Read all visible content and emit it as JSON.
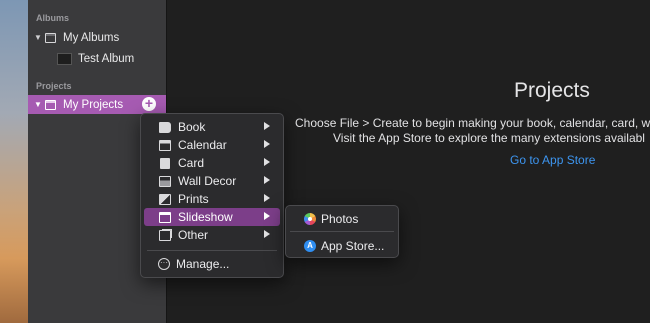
{
  "sidebar": {
    "albums_header": "Albums",
    "my_albums_label": "My Albums",
    "test_album_label": "Test Album",
    "projects_header": "Projects",
    "my_projects_label": "My Projects",
    "add_symbol": "+",
    "disclosure_symbol": "▼"
  },
  "main": {
    "title": "Projects",
    "line1": "Choose File > Create to begin making your book, calendar, card, w",
    "line2": "Visit the App Store to explore the many extensions availabl",
    "store_link": "Go to App Store"
  },
  "context_menu": {
    "items": [
      {
        "label": "Book",
        "icon": "book-icon"
      },
      {
        "label": "Calendar",
        "icon": "calendar-icon"
      },
      {
        "label": "Card",
        "icon": "card-icon"
      },
      {
        "label": "Wall Decor",
        "icon": "wall-decor-icon"
      },
      {
        "label": "Prints",
        "icon": "prints-icon"
      },
      {
        "label": "Slideshow",
        "icon": "slideshow-icon"
      },
      {
        "label": "Other",
        "icon": "other-icon"
      }
    ],
    "manage_label": "Manage...",
    "highlighted_item": "Slideshow"
  },
  "submenu": {
    "items": [
      {
        "label": "Photos",
        "icon": "photos-icon"
      },
      {
        "label": "App Store...",
        "icon": "app-store-icon"
      }
    ]
  },
  "colors": {
    "selection": "#a65bb2",
    "menu_highlight": "#7c3e89",
    "link": "#3d95ef"
  }
}
